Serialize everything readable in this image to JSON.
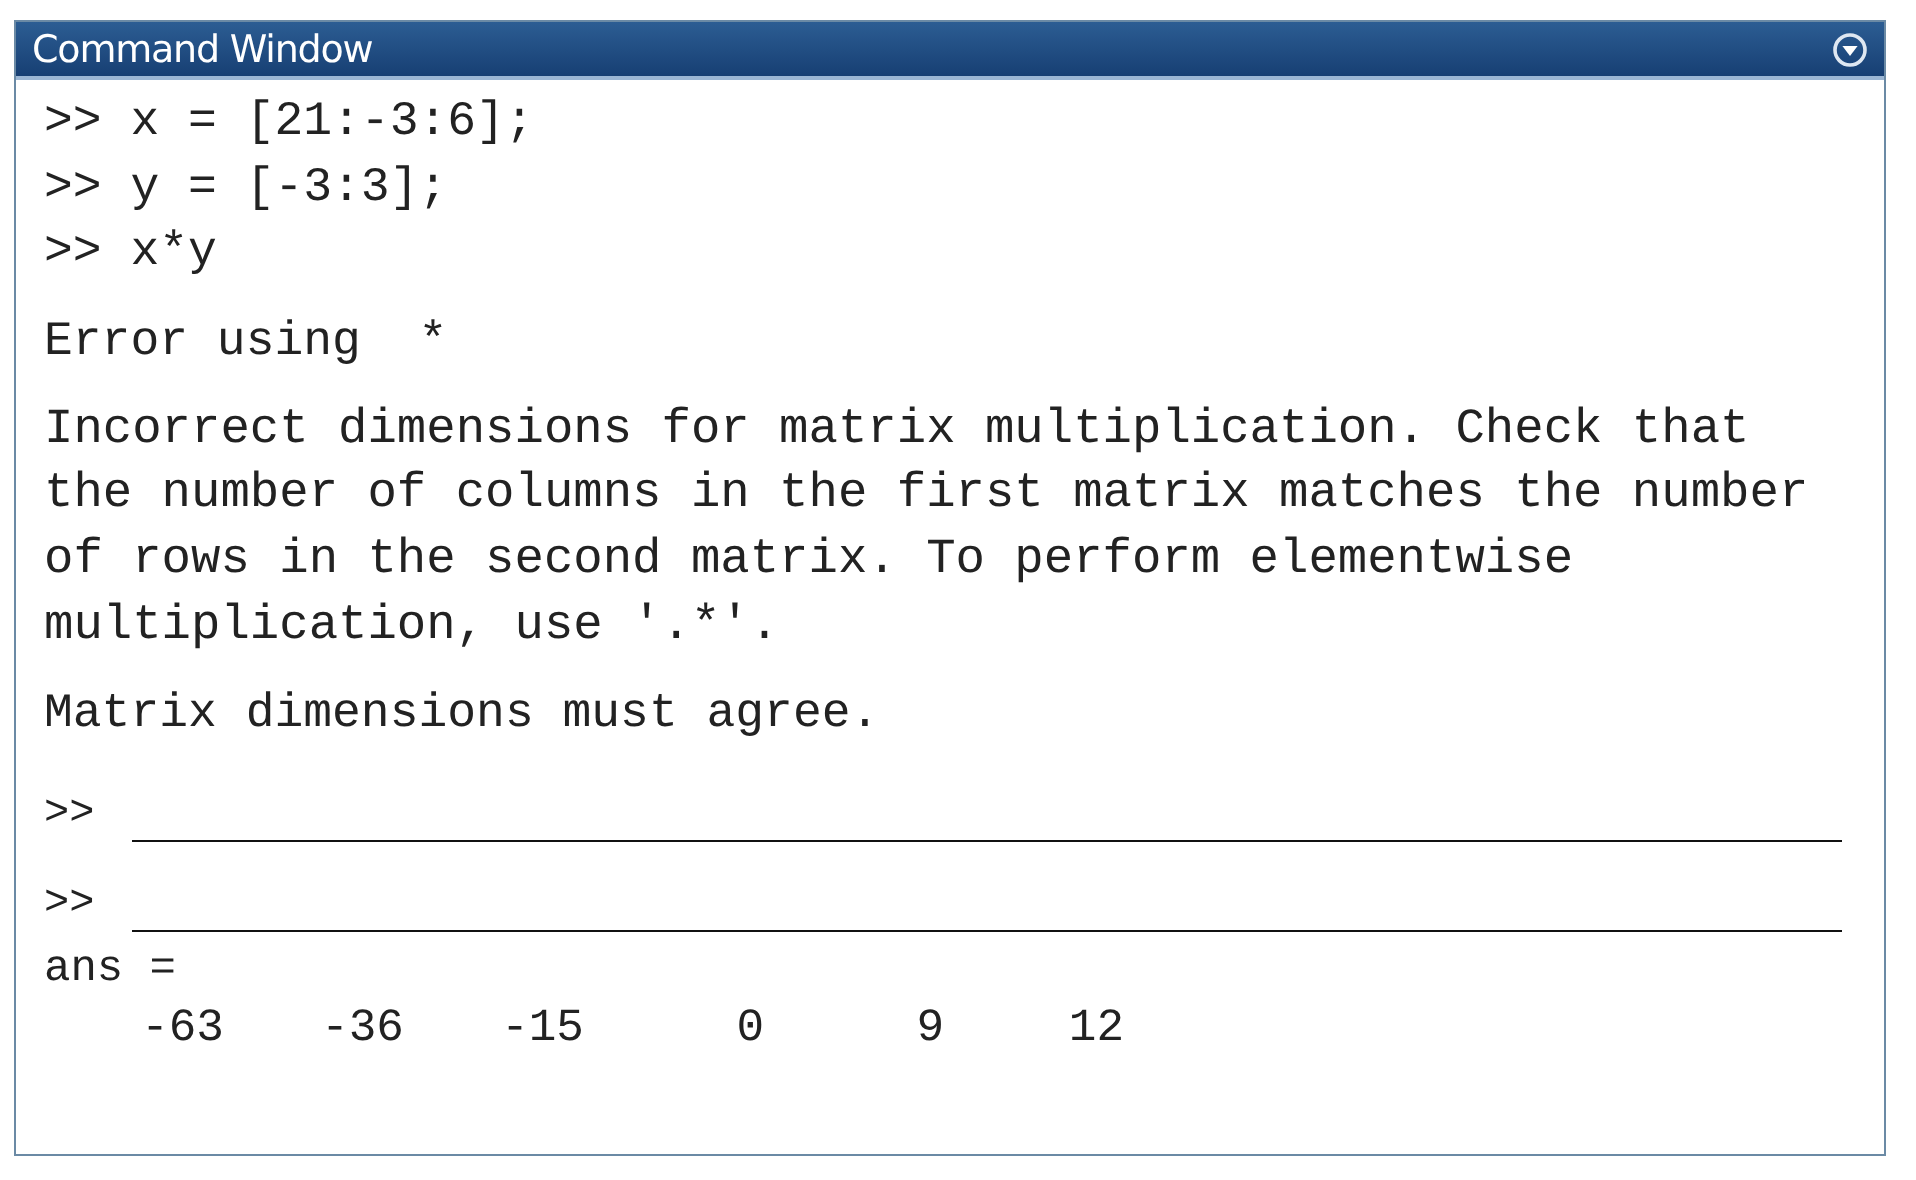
{
  "window": {
    "title": "Command Window"
  },
  "commands": [
    {
      "prompt": ">>",
      "text": "x = [21:-3:6];"
    },
    {
      "prompt": ">>",
      "text": "y = [-3:3];"
    },
    {
      "prompt": ">>",
      "text": "x*y"
    }
  ],
  "error": {
    "heading": "Error using  *",
    "message": "Incorrect dimensions for matrix multiplication. Check that the number of columns in the first matrix matches the number of rows in the second matrix. To perform elementwise multiplication, use '.*'.",
    "note": "Matrix dimensions must agree."
  },
  "blanks": [
    {
      "prompt": ">>"
    },
    {
      "prompt": ">>"
    }
  ],
  "answer": {
    "label": "ans =",
    "values": [
      "-63",
      "-36",
      "-15",
      "0",
      "9",
      "12"
    ]
  }
}
